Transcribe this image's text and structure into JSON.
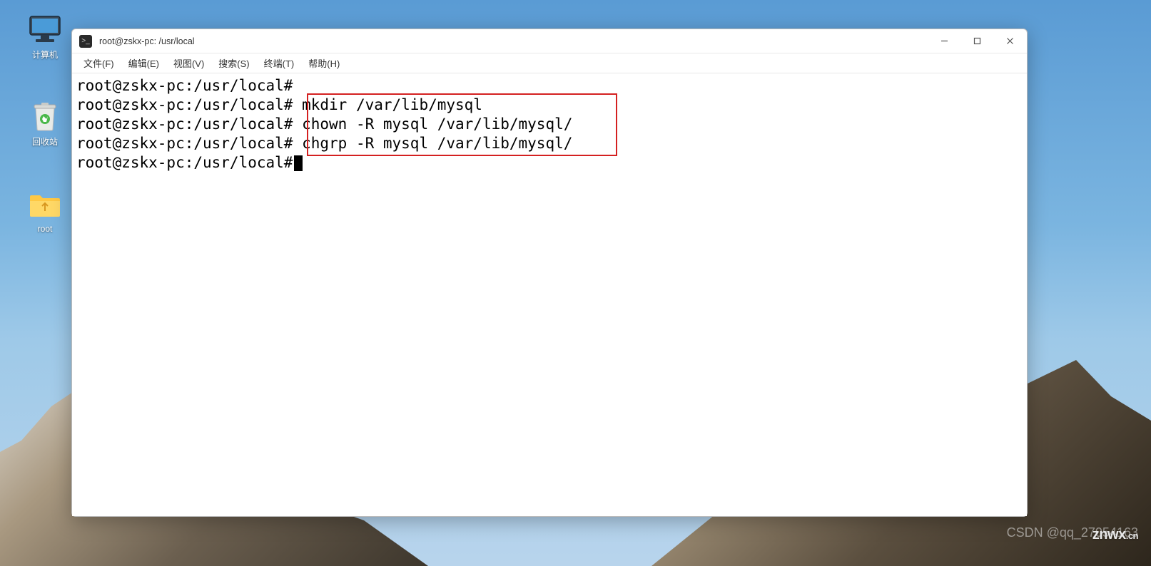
{
  "desktop": {
    "icons": {
      "computer": "计算机",
      "trash": "回收站",
      "root_folder": "root"
    }
  },
  "window": {
    "title": "root@zskx-pc: /usr/local"
  },
  "menubar": {
    "file": "文件(F)",
    "edit": "编辑(E)",
    "view": "视图(V)",
    "search": "搜索(S)",
    "terminal": "终端(T)",
    "help": "帮助(H)"
  },
  "terminal": {
    "lines": [
      {
        "prompt": "root@zskx-pc:/usr/local#",
        "cmd": ""
      },
      {
        "prompt": "root@zskx-pc:/usr/local#",
        "cmd": " mkdir /var/lib/mysql"
      },
      {
        "prompt": "root@zskx-pc:/usr/local#",
        "cmd": " chown -R mysql /var/lib/mysql/"
      },
      {
        "prompt": "root@zskx-pc:/usr/local#",
        "cmd": " chgrp -R mysql /var/lib/mysql/"
      },
      {
        "prompt": "root@zskx-pc:/usr/local#",
        "cmd": "",
        "cursor": true
      }
    ]
  },
  "watermark": {
    "csdn": "CSDN @qq_27054163",
    "znwx": "znwx",
    "znwx_cn": ".cn"
  }
}
